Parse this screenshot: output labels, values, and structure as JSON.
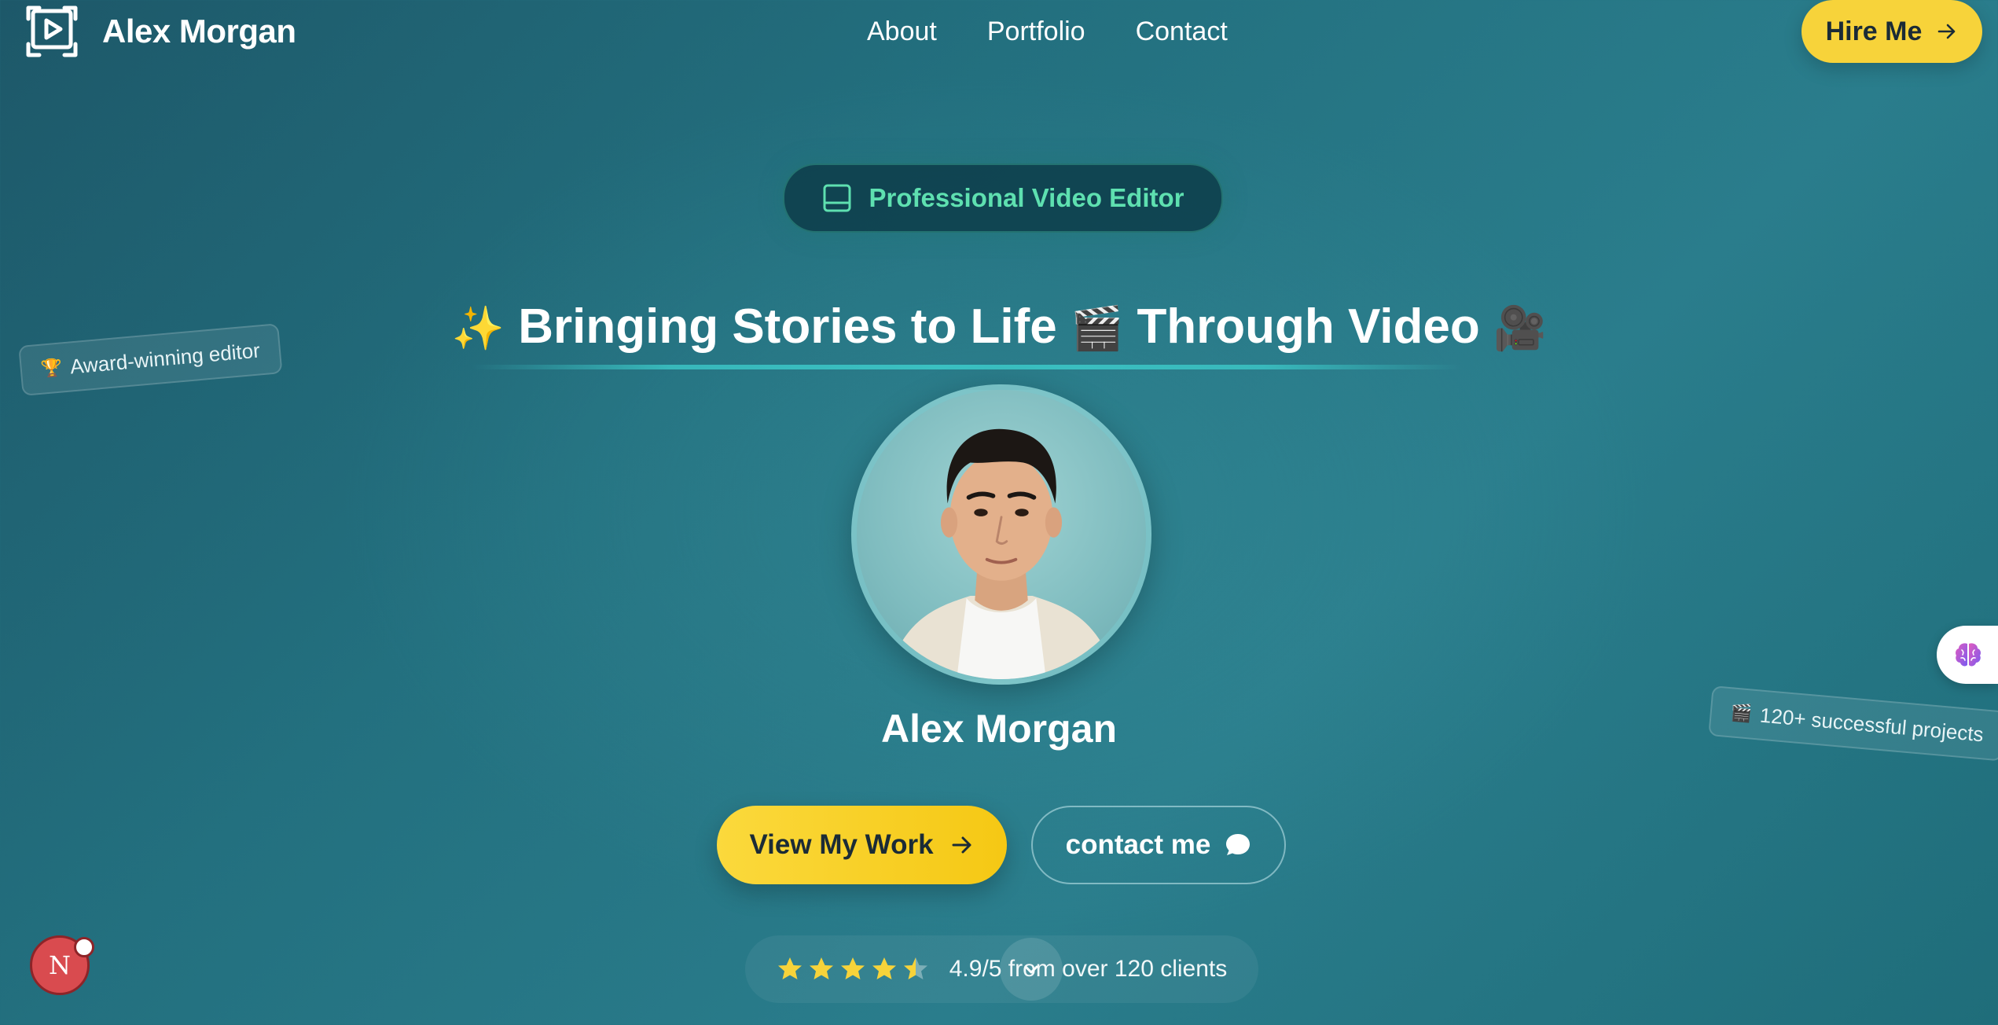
{
  "brand": {
    "name": "Alex Morgan",
    "logo_icon": "play-frame-icon"
  },
  "nav": {
    "items": [
      {
        "label": "About"
      },
      {
        "label": "Portfolio"
      },
      {
        "label": "Contact"
      }
    ]
  },
  "header": {
    "hire_label": "Hire Me",
    "hire_icon": "arrow-right-icon"
  },
  "hero": {
    "badge_label": "Professional Video Editor",
    "badge_icon": "panel-icon",
    "headline": {
      "emoji_start": "✨",
      "text_part1": "Bringing Stories to Life",
      "emoji_mid": "🎬",
      "text_part2": "Through Video",
      "emoji_end": "🎥"
    },
    "profile_name": "Alex Morgan",
    "primary_cta": "View My Work",
    "secondary_cta": "contact me"
  },
  "rating": {
    "stars": 4.5,
    "max_stars": 5,
    "text": "4.9/5 from over 120 clients"
  },
  "floating_tags": {
    "left": {
      "icon": "🏆",
      "label": "Award-winning editor"
    },
    "right": {
      "icon": "🎬",
      "label": "120+ successful projects"
    }
  },
  "widgets": {
    "n_badge_letter": "N"
  },
  "colors": {
    "accent": "#f7d33a",
    "badge_text": "#5ee0b0",
    "background": "#23707f"
  }
}
